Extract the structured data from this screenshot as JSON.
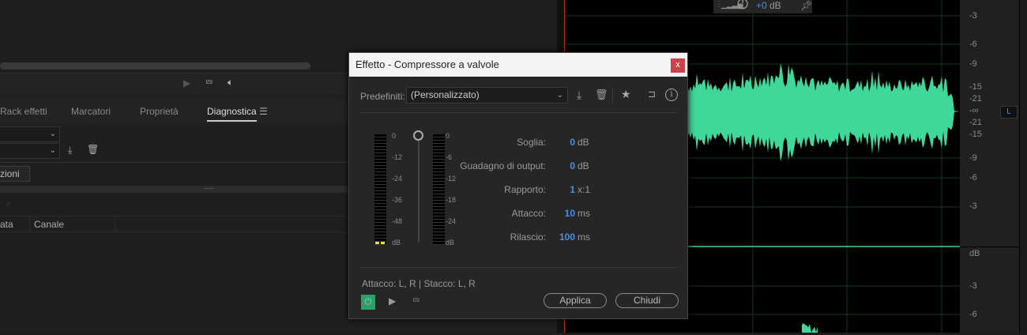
{
  "left_panel": {
    "tabs": [
      "Rack effetti",
      "Marcatori",
      "Proprietà",
      "Diagnostica"
    ],
    "active_tab": "Diagnostica",
    "button_partial": "zioni",
    "columns": [
      "ata",
      "Canale"
    ]
  },
  "hud": {
    "gain": "+0",
    "unit": "dB"
  },
  "ruler": {
    "top_labels": [
      "-3",
      "-6",
      "-9",
      "-15",
      "-21",
      "-∞",
      "-21",
      "-15",
      "-9",
      "-6",
      "-3"
    ],
    "db": "dB",
    "bottom_labels": [
      "-3",
      "-6"
    ],
    "channel": "L"
  },
  "dialog": {
    "title": "Effetto - Compressore a valvole",
    "close": "x",
    "preset_label": "Predefiniti:",
    "preset_value": "(Personalizzato)",
    "meter_in_ticks": [
      "0",
      "-12",
      "-24",
      "-36",
      "-48",
      "dB"
    ],
    "meter_out_ticks": [
      "0",
      "-6",
      "-12",
      "-18",
      "-24",
      "dB"
    ],
    "params": [
      {
        "label": "Soglia:",
        "value": "0",
        "unit": "dB"
      },
      {
        "label": "Guadagno di output:",
        "value": "0",
        "unit": "dB"
      },
      {
        "label": "Rapporto:",
        "value": "1",
        "unit": "x:1"
      },
      {
        "label": "Attacco:",
        "value": "10",
        "unit": "ms"
      },
      {
        "label": "Rilascio:",
        "value": "100",
        "unit": "ms"
      }
    ],
    "status": "Attacco: L, R | Stacco: L, R",
    "apply": "Applica",
    "close_btn": "Chiudi"
  },
  "colors": {
    "waveform": "#3fd89a",
    "accent": "#4c8fe0",
    "power": "#2f9e6b"
  }
}
